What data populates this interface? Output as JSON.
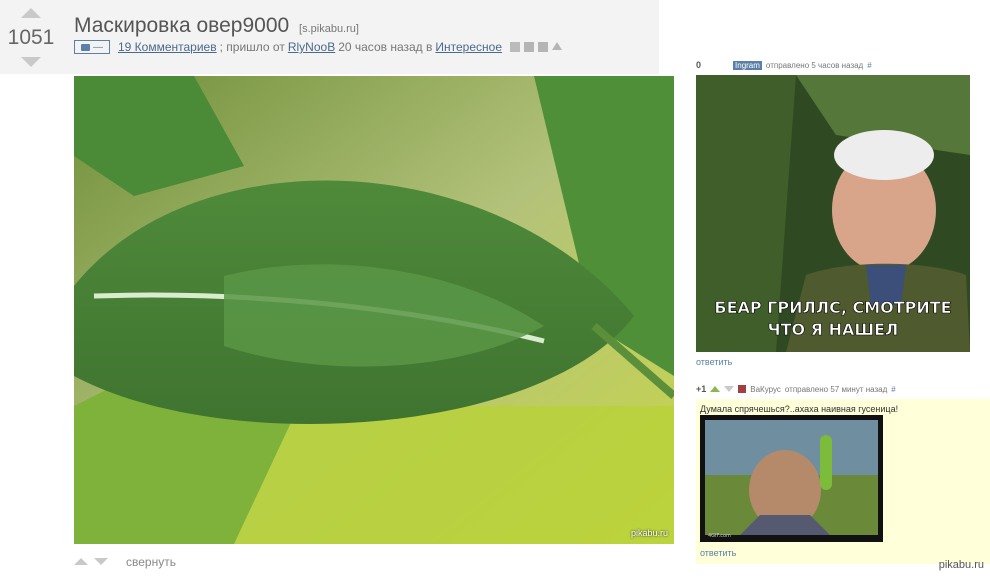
{
  "post": {
    "rating": "1051",
    "title": "Маскировка овер9000",
    "source": "[s.pikabu.ru]",
    "photo_badge": "—",
    "comments_link": "19 Комментариев",
    "came_from": "; пришло от",
    "author": "RlyNooB",
    "time_in": "20 часов назад в",
    "category": "Интересное",
    "image_watermark": "pikabu.ru",
    "collapse_label": "свернуть"
  },
  "comments": [
    {
      "score": "0",
      "user": "Ingram",
      "time": "отправлено 5 часов назад",
      "hash": "#",
      "meme_line1": "БЕАР ГРИЛЛС, СМОТРИТЕ",
      "meme_line2": "ЧТО Я НАШЕЛ",
      "reply": "ответить"
    },
    {
      "score": "+1",
      "user": "ВаКурус",
      "time": "отправлено 57 минут назад",
      "hash": "#",
      "text": "Думала спрячешься?..ахаха наивная гусеница!",
      "image_caption": "4GIF.com",
      "reply": "ответить",
      "highlight_color": "#ffffd9"
    }
  ],
  "site_watermark": "pikabu.ru",
  "colors": {
    "link": "#5a7fa8",
    "vote_arrow": "#c9c9c9",
    "upvote_active": "#8ab84c"
  }
}
